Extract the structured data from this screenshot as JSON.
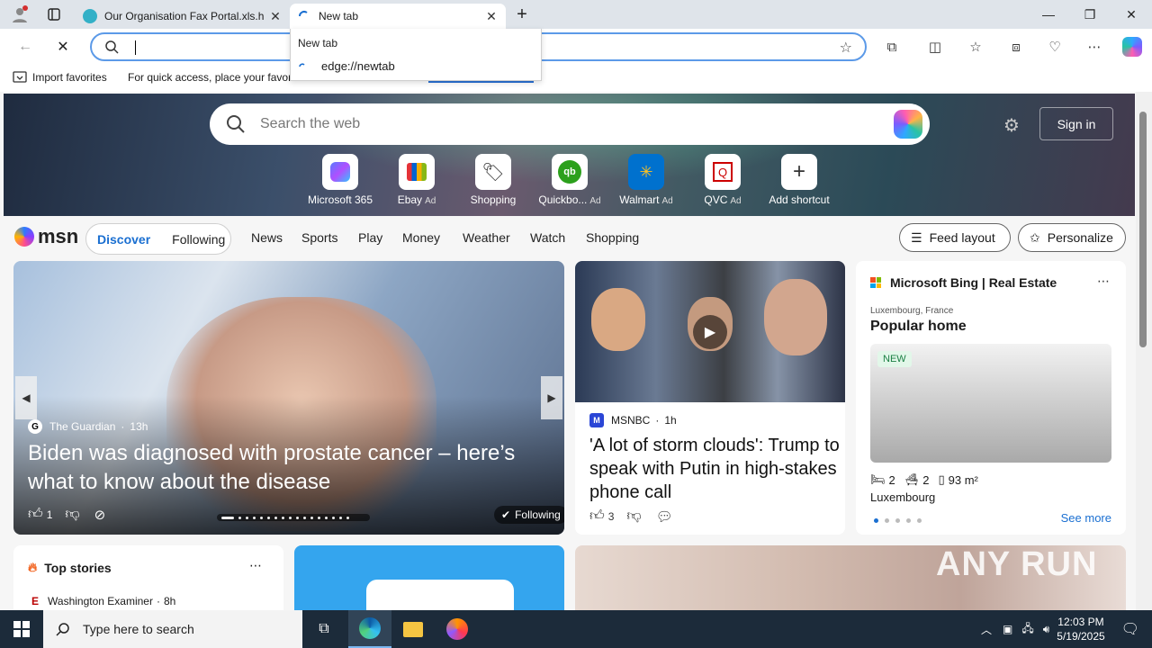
{
  "browser": {
    "tabs": [
      {
        "label": "Our Organisation Fax Portal.xls.h",
        "active": false
      },
      {
        "label": "New tab",
        "active": true
      }
    ],
    "omnibox_value": "",
    "dropdown": {
      "header": "New tab",
      "suggestion": "edge://newtab"
    },
    "favorites": {
      "import": "Import favorites",
      "tip": "For quick access, place your favori"
    }
  },
  "newtab": {
    "search_placeholder": "Search the web",
    "sign_in": "Sign in",
    "shortcuts": [
      {
        "label": "Microsoft 365",
        "ad": ""
      },
      {
        "label": "Ebay",
        "ad": "Ad"
      },
      {
        "label": "Shopping",
        "ad": ""
      },
      {
        "label": "Quickbo...",
        "ad": "Ad"
      },
      {
        "label": "Walmart",
        "ad": "Ad"
      },
      {
        "label": "QVC",
        "ad": "Ad"
      },
      {
        "label": "Add shortcut",
        "ad": ""
      }
    ]
  },
  "msn": {
    "logo": "msn",
    "segments": {
      "discover": "Discover",
      "following": "Following"
    },
    "nav": [
      "News",
      "Sports",
      "Play",
      "Money",
      "Weather",
      "Watch",
      "Shopping"
    ],
    "feed_layout": "Feed layout",
    "personalize": "Personalize"
  },
  "cards": {
    "main": {
      "source": "The Guardian",
      "age": "13h",
      "headline": "Biden was diagnosed with prostate cancer – here’s what to know about the disease",
      "likes": "1",
      "following": "Following"
    },
    "second": {
      "source": "MSNBC",
      "age": "1h",
      "headline": "'A lot of storm clouds': Trump to speak with Putin in high-stakes phone call",
      "likes": "3"
    },
    "realestate": {
      "brand": "Microsoft Bing | Real Estate",
      "location": "Luxembourg, France",
      "title": "Popular home",
      "badge": "NEW",
      "beds": "2",
      "baths": "2",
      "area": "93 m²",
      "city": "Luxembourg",
      "see_more": "See more"
    },
    "topstories": {
      "title": "Top stories",
      "item_source": "Washington Examiner",
      "item_age": "8h"
    }
  },
  "watermark": "ANY RUN",
  "taskbar": {
    "search_placeholder": "Type here to search",
    "time": "12:03 PM",
    "date": "5/19/2025"
  }
}
